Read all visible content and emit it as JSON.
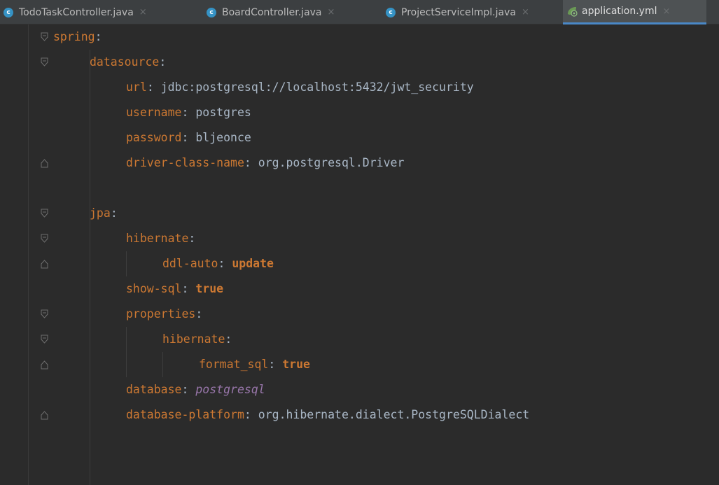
{
  "tabs": [
    {
      "label": "TodoTaskController.java",
      "icon": "java-class-icon",
      "close": "×",
      "active": false
    },
    {
      "label": "BoardController.java",
      "icon": "java-class-icon",
      "close": "×",
      "active": false
    },
    {
      "label": "ProjectServiceImpl.java",
      "icon": "java-class-icon",
      "close": "×",
      "active": false
    },
    {
      "label": "application.yml",
      "icon": "spring-config-icon",
      "close": "×",
      "active": true
    }
  ],
  "colors": {
    "background": "#2b2b2b",
    "tabbar": "#3c3f41",
    "active_tab": "#4e5254",
    "active_underline": "#4a88c7",
    "key": "#cc7832",
    "value": "#a9b7c6",
    "enum_value": "#9876aa"
  },
  "code": [
    {
      "key": "spring",
      "sep": ":",
      "value": "",
      "value_style": "plain"
    },
    {
      "key": "datasource",
      "sep": ":",
      "value": "",
      "value_style": "plain"
    },
    {
      "key": "url",
      "sep": ": ",
      "value": "jdbc:postgresql://localhost:5432/jwt_security",
      "value_style": "plain"
    },
    {
      "key": "username",
      "sep": ": ",
      "value": "postgres",
      "value_style": "plain"
    },
    {
      "key": "password",
      "sep": ": ",
      "value": "bljeonce",
      "value_style": "plain"
    },
    {
      "key": "driver-class-name",
      "sep": ": ",
      "value": "org.postgresql.Driver",
      "value_style": "plain"
    },
    {
      "key": "",
      "sep": "",
      "value": "",
      "value_style": "plain"
    },
    {
      "key": "jpa",
      "sep": ":",
      "value": "",
      "value_style": "plain"
    },
    {
      "key": "hibernate",
      "sep": ":",
      "value": "",
      "value_style": "plain"
    },
    {
      "key": "ddl-auto",
      "sep": ": ",
      "value": "update",
      "value_style": "keyword"
    },
    {
      "key": "show-sql",
      "sep": ": ",
      "value": "true",
      "value_style": "keyword"
    },
    {
      "key": "properties",
      "sep": ":",
      "value": "",
      "value_style": "plain"
    },
    {
      "key": "hibernate",
      "sep": ":",
      "value": "",
      "value_style": "plain"
    },
    {
      "key": "format_sql",
      "sep": ": ",
      "value": "true",
      "value_style": "keyword"
    },
    {
      "key": "database",
      "sep": ": ",
      "value": "postgresql",
      "value_style": "enum"
    },
    {
      "key": "database-platform",
      "sep": ": ",
      "value": "org.hibernate.dialect.PostgreSQLDialect",
      "value_style": "plain"
    }
  ]
}
